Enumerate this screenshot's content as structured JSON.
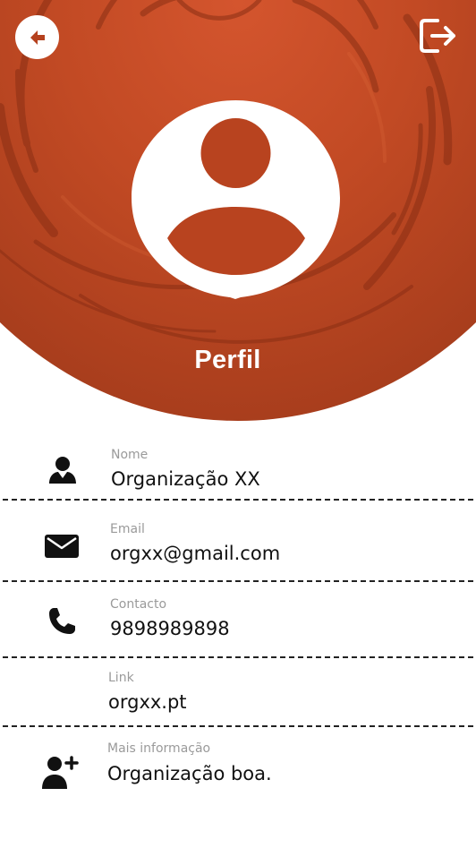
{
  "header": {
    "title": "Perfil",
    "back_icon": "arrow-left-icon",
    "logout_icon": "logout-icon",
    "accent_color": "#c24a24"
  },
  "profile": {
    "avatar_icon": "user-avatar-icon",
    "fields": [
      {
        "label": "Nome",
        "value": "Organização XX",
        "icon": "person-icon"
      },
      {
        "label": "Email",
        "value": "orgxx@gmail.com",
        "icon": "mail-icon"
      },
      {
        "label": "Contacto",
        "value": "9898989898",
        "icon": "phone-icon"
      },
      {
        "label": "Link",
        "value": "orgxx.pt",
        "icon": ""
      },
      {
        "label": "Mais informação",
        "value": "Organização boa.",
        "icon": "person-add-icon"
      }
    ]
  }
}
